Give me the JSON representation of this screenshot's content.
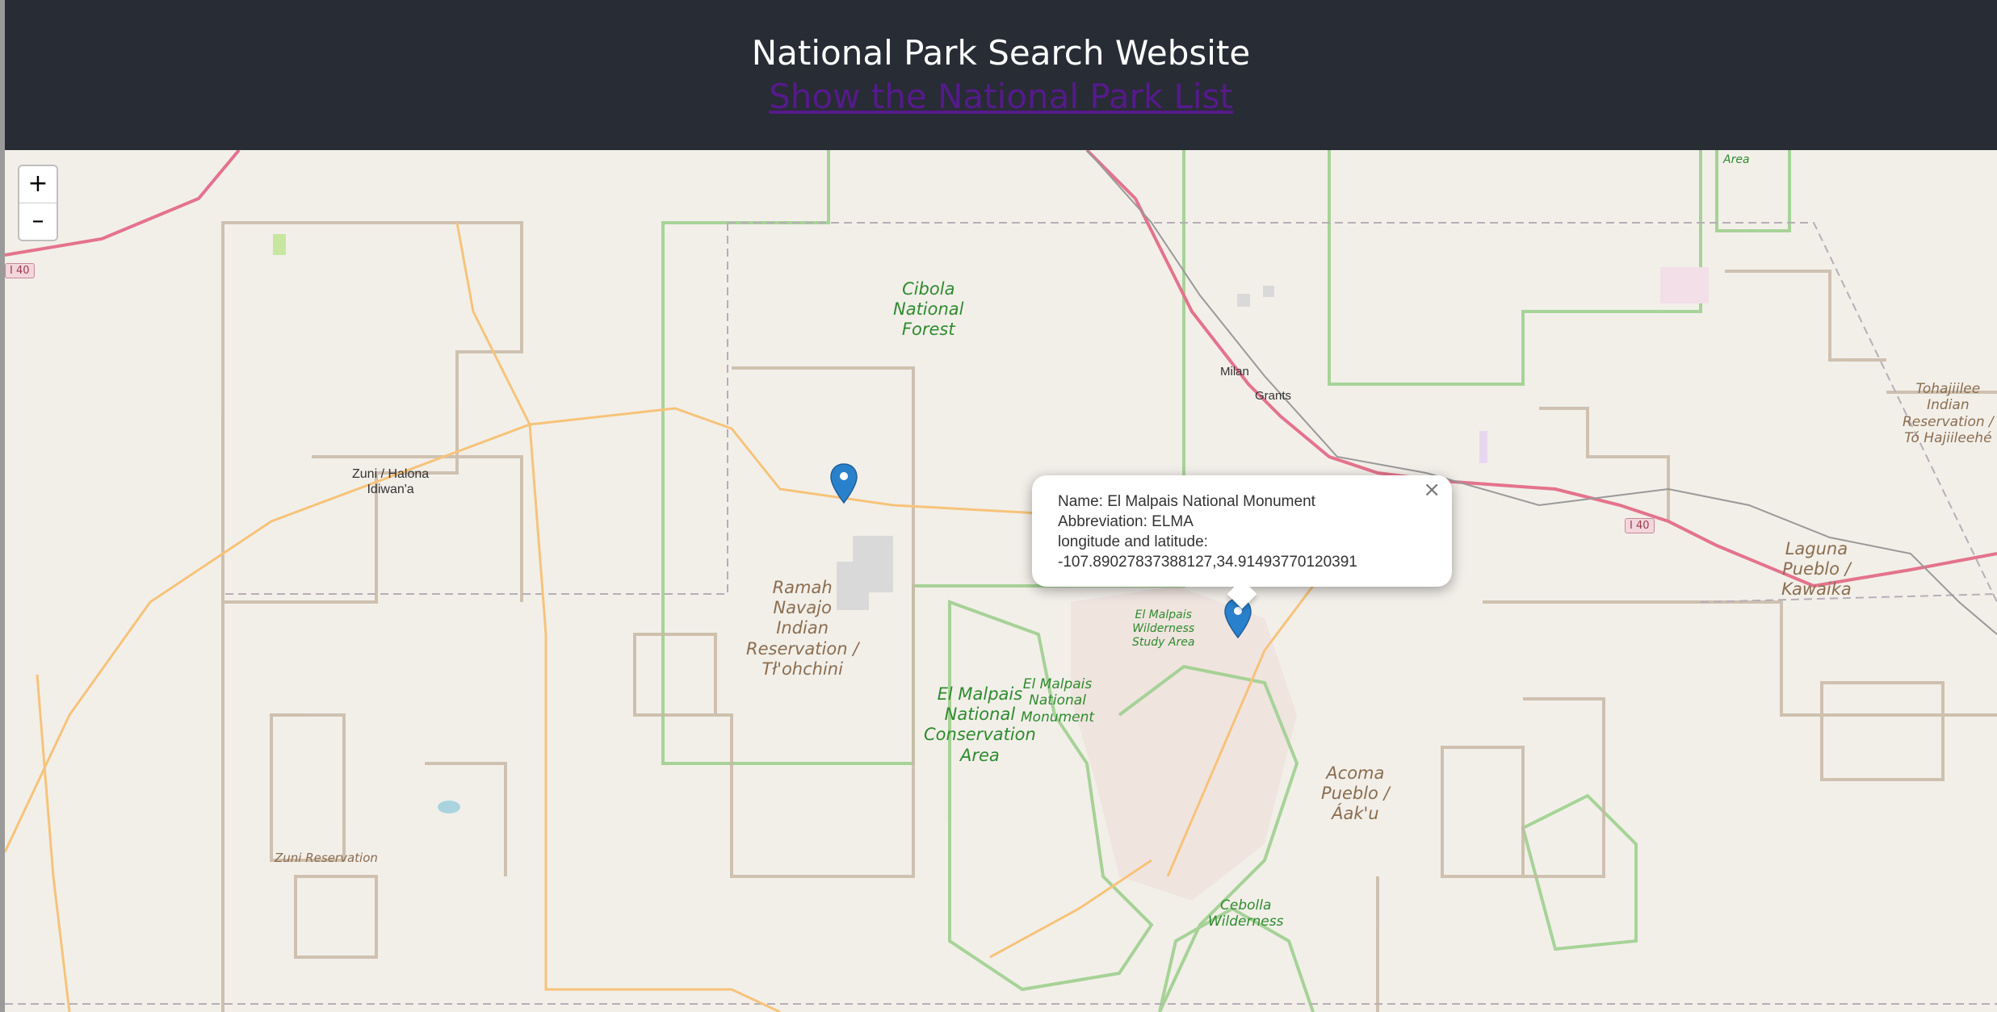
{
  "header": {
    "title": "National Park Search Website",
    "link_label": "Show the National Park List"
  },
  "map": {
    "zoom_in_label": "+",
    "zoom_out_label": "–",
    "labels": {
      "cibola": [
        "Cibola",
        "National",
        "Forest"
      ],
      "zuni_halona": [
        "Zuni / Halona",
        "Idiwan'a"
      ],
      "milan": "Milan",
      "grants": "Grants",
      "ramah": [
        "Ramah",
        "Navajo",
        "Indian",
        "Reservation /",
        "Tł'ohchini"
      ],
      "el_malpais_nca": [
        "El Malpais",
        "National",
        "Conservation",
        "Area"
      ],
      "el_malpais_nm": [
        "El Malpais",
        "National",
        "Monument"
      ],
      "el_malpais_wsa": [
        "El Malpais",
        "Wilderness",
        "Study Area"
      ],
      "acoma": [
        "Acoma",
        "Pueblo /",
        "Áak'u"
      ],
      "laguna": [
        "Laguna",
        "Pueblo /",
        "Kawaika"
      ],
      "tohajiilee": [
        "Tohajiilee",
        "Indian",
        "Reservation /",
        "Tó Hajiileehé"
      ],
      "cebolla": [
        "Cebolla",
        "Wilderness"
      ],
      "zuni_res": "Zuni Reservation",
      "area_top": "Area",
      "i40_left": "I 40",
      "i40_right": "I 40"
    },
    "markers": [
      {
        "name": "marker-unselected"
      },
      {
        "name": "marker-el-malpais"
      }
    ],
    "popup": {
      "name_line": "Name: El Malpais National Monument",
      "abbr_line": "Abbreviation: ELMA",
      "coord_label": "longitude and latitude:",
      "coord_value": "-107.89027837388127,34.91493770120391",
      "close_label": "×"
    }
  },
  "colors": {
    "header_bg": "#282c34",
    "link": "#551a8b",
    "map_bg": "#f2efe9",
    "forest_green": "#2e8b2e",
    "reservation_brown": "#8b6d4f",
    "highway": "#e4738c",
    "marker_blue": "#2a81cb"
  }
}
